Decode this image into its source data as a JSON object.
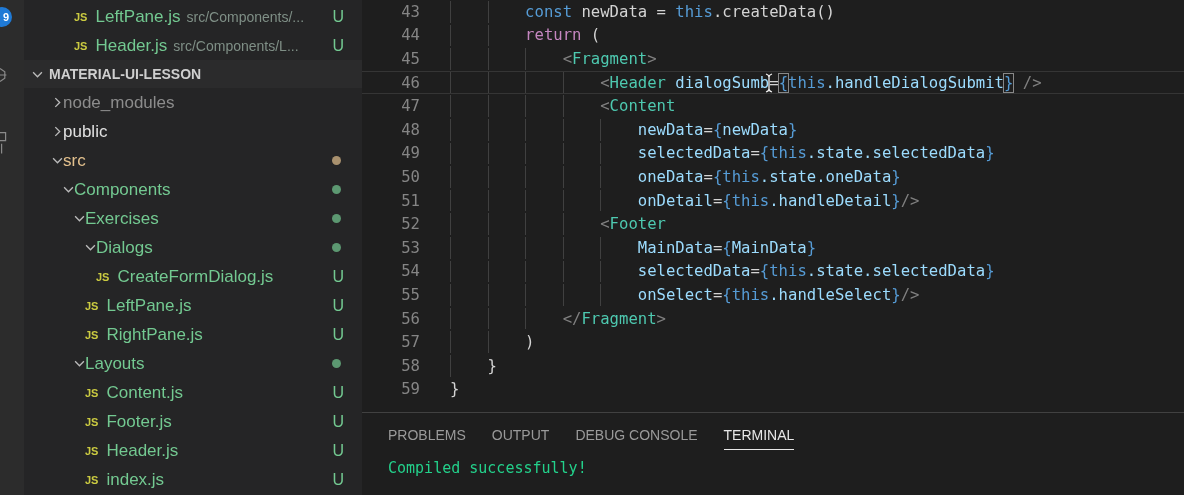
{
  "activity_bar": {
    "badge": "9"
  },
  "open_editors": [
    {
      "icon_text": "JS",
      "name": "LeftPane.js",
      "path": "src/Components/...",
      "status": "U"
    },
    {
      "icon_text": "JS",
      "name": "Header.js",
      "path": "src/Components/L...",
      "status": "U"
    }
  ],
  "explorer": {
    "title": "MATERIAL-UI-LESSON",
    "expanded": true,
    "items": [
      {
        "kind": "folder",
        "label": "node_modules",
        "expanded": false,
        "color": "#8c8c8c"
      },
      {
        "kind": "folder",
        "label": "public",
        "expanded": false,
        "color": "#e0e0e0"
      },
      {
        "kind": "folder",
        "label": "src",
        "expanded": true,
        "color": "#e2c08d",
        "dot": true,
        "children": [
          {
            "kind": "folder",
            "label": "Components",
            "expanded": true,
            "color": "#73c991",
            "dot": true,
            "children": [
              {
                "kind": "folder",
                "label": "Exercises",
                "expanded": true,
                "color": "#73c991",
                "dot": true,
                "children": [
                  {
                    "kind": "folder",
                    "label": "Dialogs",
                    "expanded": true,
                    "color": "#73c991",
                    "dot": true,
                    "children": [
                      {
                        "kind": "file",
                        "icon_text": "JS",
                        "label": "CreateFormDialog.js",
                        "color": "#73c991",
                        "status": "U"
                      }
                    ]
                  },
                  {
                    "kind": "file",
                    "icon_text": "JS",
                    "label": "LeftPane.js",
                    "color": "#73c991",
                    "status": "U"
                  },
                  {
                    "kind": "file",
                    "icon_text": "JS",
                    "label": "RightPane.js",
                    "color": "#73c991",
                    "status": "U"
                  }
                ]
              },
              {
                "kind": "folder",
                "label": "Layouts",
                "expanded": true,
                "color": "#73c991",
                "dot": true,
                "children": [
                  {
                    "kind": "file",
                    "icon_text": "JS",
                    "label": "Content.js",
                    "color": "#73c991",
                    "status": "U"
                  },
                  {
                    "kind": "file",
                    "icon_text": "JS",
                    "label": "Footer.js",
                    "color": "#73c991",
                    "status": "U"
                  },
                  {
                    "kind": "file",
                    "icon_text": "JS",
                    "label": "Header.js",
                    "color": "#73c991",
                    "status": "U"
                  },
                  {
                    "kind": "file",
                    "icon_text": "JS",
                    "label": "index.js",
                    "color": "#73c991",
                    "status": "U"
                  }
                ]
              }
            ]
          }
        ]
      }
    ]
  },
  "editor": {
    "lines": [
      {
        "number": "43",
        "current": false,
        "tokens": [
          {
            "kind": "keyword",
            "text": "        const"
          },
          {
            "kind": "plain",
            "text": " newData = "
          },
          {
            "kind": "keyword",
            "text": "this"
          },
          {
            "kind": "plain",
            "text": ".createData()"
          }
        ]
      },
      {
        "number": "44",
        "current": false,
        "tokens": [
          {
            "kind": "control",
            "text": "        return"
          },
          {
            "kind": "plain",
            "text": " ("
          }
        ]
      },
      {
        "number": "45",
        "current": false,
        "tokens": [
          {
            "kind": "punct",
            "text": "            <"
          },
          {
            "kind": "tag",
            "text": "Fragment"
          },
          {
            "kind": "punct",
            "text": ">"
          }
        ]
      },
      {
        "number": "46",
        "current": true,
        "tokens": [
          {
            "kind": "punct",
            "text": "                <"
          },
          {
            "kind": "tag",
            "text": "Header"
          },
          {
            "kind": "attr",
            "text": " dialogSumb"
          },
          {
            "kind": "cursor"
          },
          {
            "kind": "plain",
            "text": "="
          },
          {
            "kind": "brace_match",
            "text": "{"
          },
          {
            "kind": "keyword",
            "text": "this"
          },
          {
            "kind": "attr",
            "text": ".handleDialogSubmit"
          },
          {
            "kind": "brace_match",
            "text": "}"
          },
          {
            "kind": "punct",
            "text": " />"
          }
        ]
      },
      {
        "number": "47",
        "current": false,
        "tokens": [
          {
            "kind": "punct",
            "text": "                <"
          },
          {
            "kind": "tag",
            "text": "Content"
          }
        ]
      },
      {
        "number": "48",
        "current": false,
        "tokens": [
          {
            "kind": "attr",
            "text": "                    newData"
          },
          {
            "kind": "plain",
            "text": "="
          },
          {
            "kind": "brace",
            "text": "{"
          },
          {
            "kind": "attr",
            "text": "newData"
          },
          {
            "kind": "brace",
            "text": "}"
          }
        ]
      },
      {
        "number": "49",
        "current": false,
        "tokens": [
          {
            "kind": "attr",
            "text": "                    selectedData"
          },
          {
            "kind": "plain",
            "text": "="
          },
          {
            "kind": "brace",
            "text": "{"
          },
          {
            "kind": "keyword",
            "text": "this"
          },
          {
            "kind": "attr",
            "text": ".state.selectedData"
          },
          {
            "kind": "brace",
            "text": "}"
          }
        ]
      },
      {
        "number": "50",
        "current": false,
        "tokens": [
          {
            "kind": "attr",
            "text": "                    oneData"
          },
          {
            "kind": "plain",
            "text": "="
          },
          {
            "kind": "brace",
            "text": "{"
          },
          {
            "kind": "keyword",
            "text": "this"
          },
          {
            "kind": "attr",
            "text": ".state.oneData"
          },
          {
            "kind": "brace",
            "text": "}"
          }
        ]
      },
      {
        "number": "51",
        "current": false,
        "tokens": [
          {
            "kind": "attr",
            "text": "                    onDetail"
          },
          {
            "kind": "plain",
            "text": "="
          },
          {
            "kind": "brace",
            "text": "{"
          },
          {
            "kind": "keyword",
            "text": "this"
          },
          {
            "kind": "attr",
            "text": ".handleDetail"
          },
          {
            "kind": "brace",
            "text": "}"
          },
          {
            "kind": "punct",
            "text": "/>"
          }
        ]
      },
      {
        "number": "52",
        "current": false,
        "tokens": [
          {
            "kind": "punct",
            "text": "                <"
          },
          {
            "kind": "tag",
            "text": "Footer"
          }
        ]
      },
      {
        "number": "53",
        "current": false,
        "tokens": [
          {
            "kind": "attr",
            "text": "                    MainData"
          },
          {
            "kind": "plain",
            "text": "="
          },
          {
            "kind": "brace",
            "text": "{"
          },
          {
            "kind": "attr",
            "text": "MainData"
          },
          {
            "kind": "brace",
            "text": "}"
          }
        ]
      },
      {
        "number": "54",
        "current": false,
        "tokens": [
          {
            "kind": "attr",
            "text": "                    selectedData"
          },
          {
            "kind": "plain",
            "text": "="
          },
          {
            "kind": "brace",
            "text": "{"
          },
          {
            "kind": "keyword",
            "text": "this"
          },
          {
            "kind": "attr",
            "text": ".state.selectedData"
          },
          {
            "kind": "brace",
            "text": "}"
          }
        ]
      },
      {
        "number": "55",
        "current": false,
        "tokens": [
          {
            "kind": "attr",
            "text": "                    onSelect"
          },
          {
            "kind": "plain",
            "text": "="
          },
          {
            "kind": "brace",
            "text": "{"
          },
          {
            "kind": "keyword",
            "text": "this"
          },
          {
            "kind": "attr",
            "text": ".handleSelect"
          },
          {
            "kind": "brace",
            "text": "}"
          },
          {
            "kind": "punct",
            "text": "/>"
          }
        ]
      },
      {
        "number": "56",
        "current": false,
        "tokens": [
          {
            "kind": "punct",
            "text": "            </"
          },
          {
            "kind": "tag",
            "text": "Fragment"
          },
          {
            "kind": "punct",
            "text": ">"
          }
        ]
      },
      {
        "number": "57",
        "current": false,
        "tokens": [
          {
            "kind": "plain",
            "text": "        )"
          }
        ]
      },
      {
        "number": "58",
        "current": false,
        "tokens": [
          {
            "kind": "plain",
            "text": "    }"
          }
        ]
      },
      {
        "number": "59",
        "current": false,
        "tokens": [
          {
            "kind": "plain",
            "text": "}"
          }
        ]
      }
    ]
  },
  "panel": {
    "tabs": [
      {
        "label": "PROBLEMS",
        "selected": false
      },
      {
        "label": "OUTPUT",
        "selected": false
      },
      {
        "label": "DEBUG CONSOLE",
        "selected": false
      },
      {
        "label": "TERMINAL",
        "selected": true
      }
    ],
    "output": "Compiled successfully!"
  }
}
